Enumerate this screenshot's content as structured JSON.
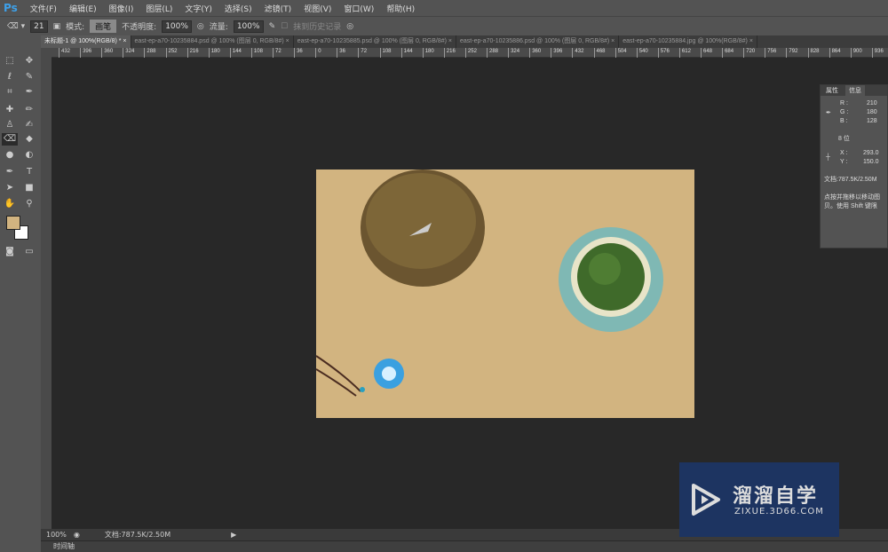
{
  "app": {
    "logo": "Ps"
  },
  "menu": [
    "文件(F)",
    "编辑(E)",
    "图像(I)",
    "图层(L)",
    "文字(Y)",
    "选择(S)",
    "滤镜(T)",
    "视图(V)",
    "窗口(W)",
    "帮助(H)"
  ],
  "options": {
    "brush_size": "21",
    "mode_label": "模式:",
    "mode_value": "画笔",
    "opacity_label": "不透明度:",
    "opacity_value": "100%",
    "flow_label": "流量:",
    "flow_value": "100%",
    "erase_history_label": "抹到历史记录"
  },
  "tabs": [
    {
      "label": "未标题-1 @ 100%(RGB/8) *",
      "active": true
    },
    {
      "label": "east-ep-a70-10235884.psd @ 100% (图层 0, RGB/8#)"
    },
    {
      "label": "east-ep-a70-10235885.psd @ 100% (图层 0, RGB/8#)"
    },
    {
      "label": "east-ep-a70-10235886.psd @ 100% (图层 0, RGB/8#)"
    },
    {
      "label": "east-ep-a70-10235884.jpg @ 100%(RGB/8#)"
    }
  ],
  "ruler_labels": [
    "432",
    "396",
    "360",
    "324",
    "288",
    "252",
    "216",
    "180",
    "144",
    "108",
    "72",
    "36",
    "0",
    "36",
    "72",
    "108",
    "144",
    "180",
    "216",
    "252",
    "288",
    "324",
    "360",
    "396",
    "432",
    "468",
    "504",
    "540",
    "576",
    "612",
    "648",
    "684",
    "720",
    "756",
    "792",
    "828",
    "864",
    "900",
    "936"
  ],
  "colors": {
    "foreground": "#d2b480",
    "background": "#ffffff",
    "canvas_bg": "#d2b480"
  },
  "info_panel": {
    "tabs": [
      "属性",
      "信息"
    ],
    "active_tab": "信息",
    "R": "210",
    "G": "180",
    "B": "128",
    "bit_depth": "8 位",
    "X": "293.0",
    "Y": "150.0",
    "doc": "文档:787.5K/2.50M",
    "hint": "点按并拖移以移动图像。按 Shift 键限制…",
    "hint_line1": "点按并拖移以移动图",
    "hint_line2": "贝。使用 Shift 键限"
  },
  "status": {
    "zoom": "100%",
    "doc": "文档:787.5K/2.50M"
  },
  "timeline": {
    "label": "时间轴"
  },
  "watermark": {
    "title": "溜溜自学",
    "url": "ZIXUE.3D66.COM"
  }
}
